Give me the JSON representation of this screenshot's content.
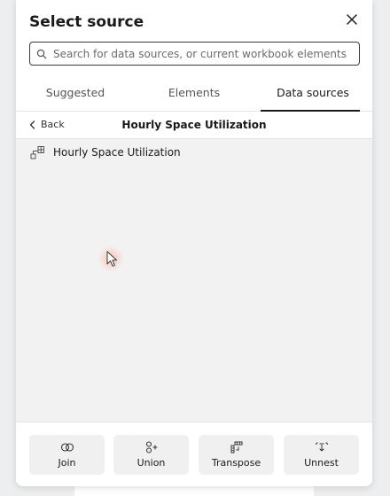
{
  "dialog": {
    "title": "Select source",
    "close_icon": "close-icon"
  },
  "search": {
    "placeholder": "Search for data sources, or current workbook elements",
    "value": "",
    "icon": "search-icon"
  },
  "tabs": [
    {
      "label": "Suggested",
      "active": false
    },
    {
      "label": "Elements",
      "active": false
    },
    {
      "label": "Data sources",
      "active": true
    }
  ],
  "breadcrumb": {
    "back_label": "Back",
    "back_icon": "chevron-left-icon",
    "title": "Hourly Space Utilization"
  },
  "list": {
    "items": [
      {
        "label": "Hourly Space Utilization",
        "icon": "dataset-icon"
      }
    ]
  },
  "actions": [
    {
      "label": "Join",
      "icon": "join-icon"
    },
    {
      "label": "Union",
      "icon": "union-icon"
    },
    {
      "label": "Transpose",
      "icon": "transpose-icon"
    },
    {
      "label": "Unnest",
      "icon": "unnest-icon"
    }
  ],
  "colors": {
    "accent": "#1a1a1a",
    "list_background": "#f2f2f2",
    "button_background": "#f0f0f0",
    "cursor_glow": "#ff9678"
  }
}
